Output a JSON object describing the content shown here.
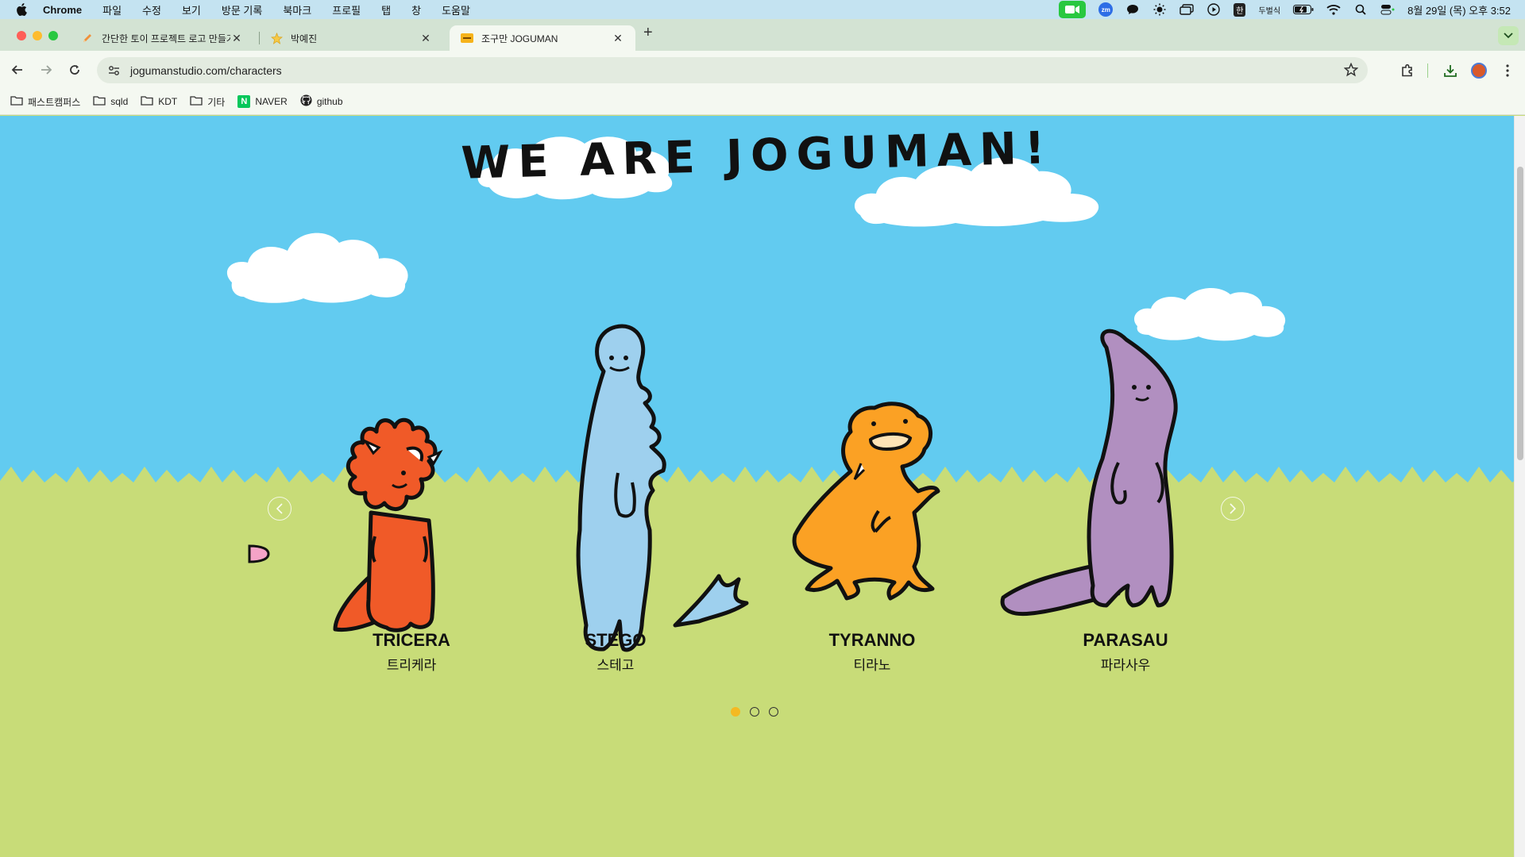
{
  "menubar": {
    "app_name": "Chrome",
    "items": [
      "파일",
      "수정",
      "보기",
      "방문 기록",
      "북마크",
      "프로필",
      "탭",
      "창",
      "도움말"
    ],
    "zoom_label": "zm",
    "ime_label": "한",
    "ime_name": "두벌식",
    "datetime": "8월 29일 (목) 오후 3:52"
  },
  "tabs": [
    {
      "title": "간단한 토이 프로젝트 로고 만들기",
      "favicon": "pencil-icon"
    },
    {
      "title": "박예진",
      "favicon": "star-icon"
    },
    {
      "title": "조구만 JOGUMAN",
      "favicon": "joguman-logo-icon"
    }
  ],
  "toolbar": {
    "url": "jogumanstudio.com/characters"
  },
  "bookmarks": [
    {
      "label": "패스트캠퍼스",
      "icon": "folder-icon"
    },
    {
      "label": "sqld",
      "icon": "folder-icon"
    },
    {
      "label": "KDT",
      "icon": "folder-icon"
    },
    {
      "label": "기타",
      "icon": "folder-icon"
    },
    {
      "label": "NAVER",
      "icon": "naver-icon"
    },
    {
      "label": "github",
      "icon": "github-icon"
    }
  ],
  "page": {
    "title": "WE ARE JOGUMAN!",
    "characters": [
      {
        "name": "TRICERA",
        "korean": "트리케라",
        "color": "#f05a28"
      },
      {
        "name": "STEGO",
        "korean": "스테고",
        "color": "#9ed0ee"
      },
      {
        "name": "TYRANNO",
        "korean": "티라노",
        "color": "#fba124"
      },
      {
        "name": "PARASAU",
        "korean": "파라사우",
        "color": "#b18fc0"
      }
    ],
    "carousel": {
      "pages": 3,
      "active": 1
    }
  },
  "colors": {
    "sky": "#62cbf0",
    "grass": "#c8dc78",
    "accent_dot": "#f4b922"
  }
}
